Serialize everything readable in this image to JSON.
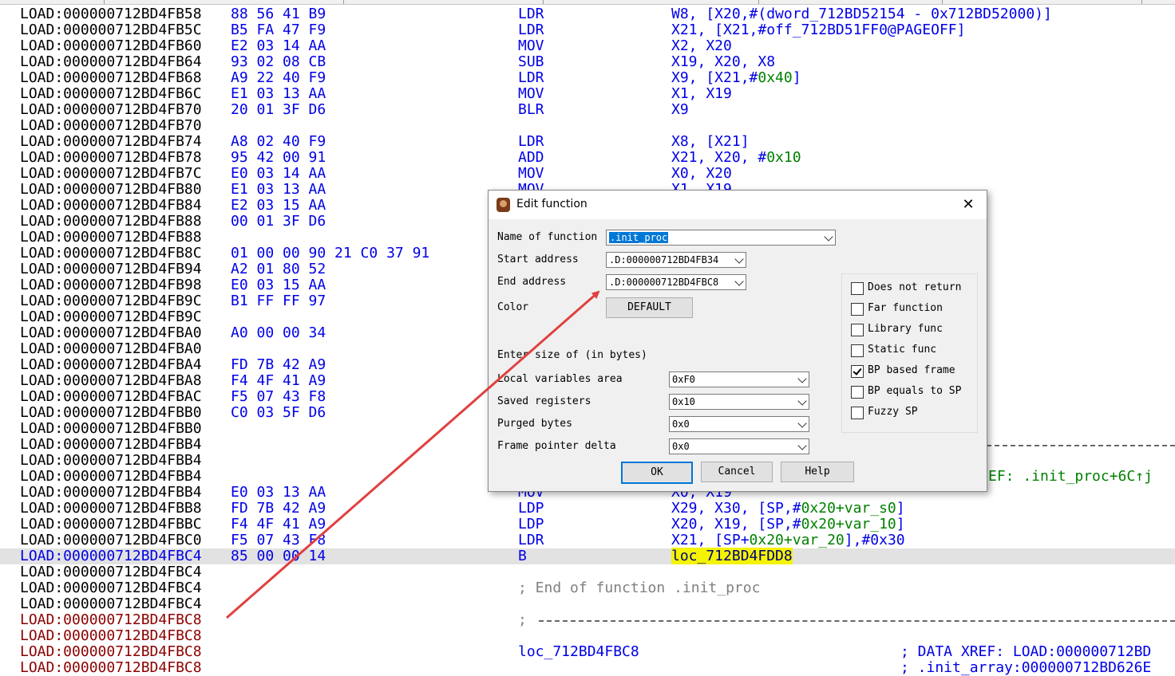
{
  "listing": {
    "rows": [
      {
        "addr": "LOAD:000000712BD4FB58",
        "bytes": "88 56 41 B9",
        "mnemonic": "LDR",
        "operands": "W8, [X20,#(dword_712BD52154 - 0x712BD52000)]"
      },
      {
        "addr": "LOAD:000000712BD4FB5C",
        "bytes": "B5 FA 47 F9",
        "mnemonic": "LDR",
        "operands": "X21, [X21,#off_712BD51FF0@PAGEOFF]"
      },
      {
        "addr": "LOAD:000000712BD4FB60",
        "bytes": "E2 03 14 AA",
        "mnemonic": "MOV",
        "operands": "X2, X20"
      },
      {
        "addr": "LOAD:000000712BD4FB64",
        "bytes": "93 02 08 CB",
        "mnemonic": "SUB",
        "operands": "X19, X20, X8"
      },
      {
        "addr": "LOAD:000000712BD4FB68",
        "bytes": "A9 22 40 F9",
        "mnemonic": "LDR",
        "operands": "X9, [X21,#",
        "operands_imm": "0x40",
        "operands_end": "]"
      },
      {
        "addr": "LOAD:000000712BD4FB6C",
        "bytes": "E1 03 13 AA",
        "mnemonic": "MOV",
        "operands": "X1, X19"
      },
      {
        "addr": "LOAD:000000712BD4FB70",
        "bytes": "20 01 3F D6",
        "mnemonic": "BLR",
        "operands": "X9"
      },
      {
        "addr": "LOAD:000000712BD4FB70",
        "bytes": "",
        "mnemonic": "",
        "operands": ""
      },
      {
        "addr": "LOAD:000000712BD4FB74",
        "bytes": "A8 02 40 F9",
        "mnemonic": "LDR",
        "operands": "X8, [X21]"
      },
      {
        "addr": "LOAD:000000712BD4FB78",
        "bytes": "95 42 00 91",
        "mnemonic": "ADD",
        "operands": "X21, X20, #",
        "operands_imm": "0x10",
        "operands_end": ""
      },
      {
        "addr": "LOAD:000000712BD4FB7C",
        "bytes": "E0 03 14 AA",
        "mnemonic": "MOV",
        "operands": "X0, X20"
      },
      {
        "addr": "LOAD:000000712BD4FB80",
        "bytes": "E1 03 13 AA",
        "mnemonic": "MOV",
        "operands": "X1, X19"
      },
      {
        "addr": "LOAD:000000712BD4FB84",
        "bytes": "E2 03 15 AA",
        "mnemonic": "",
        "operands": ""
      },
      {
        "addr": "LOAD:000000712BD4FB88",
        "bytes": "00 01 3F D6",
        "mnemonic": "",
        "operands": ""
      },
      {
        "addr": "LOAD:000000712BD4FB88",
        "bytes": "",
        "mnemonic": "",
        "operands": ""
      },
      {
        "addr": "LOAD:000000712BD4FB8C",
        "bytes": "01 00 00 90 21 C0 37 91",
        "mnemonic": "",
        "operands": ""
      },
      {
        "addr": "LOAD:000000712BD4FB94",
        "bytes": "A2 01 80 52",
        "mnemonic": "",
        "operands": ""
      },
      {
        "addr": "LOAD:000000712BD4FB98",
        "bytes": "E0 03 15 AA",
        "mnemonic": "",
        "operands": ""
      },
      {
        "addr": "LOAD:000000712BD4FB9C",
        "bytes": "B1 FF FF 97",
        "mnemonic": "",
        "operands": ""
      },
      {
        "addr": "LOAD:000000712BD4FB9C",
        "bytes": "",
        "mnemonic": "",
        "operands": ""
      },
      {
        "addr": "LOAD:000000712BD4FBA0",
        "bytes": "A0 00 00 34",
        "mnemonic": "",
        "operands": ""
      },
      {
        "addr": "LOAD:000000712BD4FBA0",
        "bytes": "",
        "mnemonic": "",
        "operands": ""
      },
      {
        "addr": "LOAD:000000712BD4FBA4",
        "bytes": "FD 7B 42 A9",
        "mnemonic": "",
        "operands": ""
      },
      {
        "addr": "LOAD:000000712BD4FBA8",
        "bytes": "F4 4F 41 A9",
        "mnemonic": "",
        "operands": ""
      },
      {
        "addr": "LOAD:000000712BD4FBAC",
        "bytes": "F5 07 43 F8",
        "mnemonic": "",
        "operands": ""
      },
      {
        "addr": "LOAD:000000712BD4FBB0",
        "bytes": "C0 03 5F D6",
        "mnemonic": "",
        "operands": ""
      },
      {
        "addr": "LOAD:000000712BD4FBB0",
        "bytes": "",
        "mnemonic": "",
        "operands": ""
      },
      {
        "addr": "LOAD:000000712BD4FBB4",
        "bytes": "",
        "mnemonic": "",
        "operands": ""
      },
      {
        "addr": "LOAD:000000712BD4FBB4",
        "bytes": "",
        "mnemonic": "",
        "operands": ""
      },
      {
        "addr": "LOAD:000000712BD4FBB4",
        "bytes": "",
        "mnemonic": "",
        "operands": "",
        "note": "EF: .init_proc+6C↑j"
      },
      {
        "addr": "LOAD:000000712BD4FBB4",
        "bytes": "E0 03 13 AA",
        "mnemonic": "MOV",
        "operands": "X0, X19"
      },
      {
        "addr": "LOAD:000000712BD4FBB8",
        "bytes": "FD 7B 42 A9",
        "mnemonic": "LDP",
        "operands": "X29, X30, [SP,#",
        "operands_imm": "0x20+var_s0",
        "operands_end": "]"
      },
      {
        "addr": "LOAD:000000712BD4FBBC",
        "bytes": "F4 4F 41 A9",
        "mnemonic": "LDP",
        "operands": "X20, X19, [SP,#",
        "operands_imm": "0x20+var_10",
        "operands_end": "]"
      },
      {
        "addr": "LOAD:000000712BD4FBC0",
        "bytes": "F5 07 43 F8",
        "mnemonic": "LDR",
        "operands": "X21, [SP+",
        "operands_imm": "0x20+var_20",
        "operands_end": "],#0x30"
      },
      {
        "addr": "LOAD:000000712BD4FBC4",
        "bytes": "85 00 00 14",
        "mnemonic": "B",
        "operands": "",
        "operands_label": "loc_712BD4FDD8"
      },
      {
        "addr": "LOAD:000000712BD4FBC4",
        "bytes": "",
        "mnemonic": "",
        "operands": ""
      },
      {
        "addr": "LOAD:000000712BD4FBC4",
        "bytes": "",
        "mnemonic": "",
        "operands": "",
        "comment": "; End of function .init_proc"
      },
      {
        "addr": "LOAD:000000712BD4FBC4",
        "bytes": "",
        "mnemonic": "",
        "operands": ""
      },
      {
        "addr": "LOAD:000000712BD4FBC8",
        "bytes": "",
        "mnemonic": "",
        "operands": "",
        "comment": "; "
      },
      {
        "addr": "LOAD:000000712BD4FBC8",
        "bytes": "",
        "mnemonic": "",
        "operands": ""
      },
      {
        "addr": "LOAD:000000712BD4FBC8",
        "bytes": "",
        "mnemonic": "",
        "operands": "",
        "label": "loc_712BD4FBC8",
        "xref1": "; DATA XREF: LOAD:000000712BD"
      },
      {
        "addr": "LOAD:000000712BD4FBC8",
        "bytes": "",
        "mnemonic": "",
        "operands": "",
        "xref2": "; .init_array:000000712BD626E"
      }
    ]
  },
  "dialog": {
    "title": "Edit function",
    "close_glyph": "✕",
    "name_label": "Name of function",
    "name_value": ".init_proc",
    "start_label": "Start address",
    "start_value": ".D:000000712BD4FB34",
    "end_label": "End address",
    "end_value": ".D:000000712BD4FBC8",
    "color_label": "Color",
    "color_button": "DEFAULT",
    "size_heading": "Enter size of (in bytes)",
    "local_label": "Local variables area",
    "local_value": "0xF0",
    "saved_label": "Saved registers",
    "saved_value": "0x10",
    "purged_label": "Purged bytes",
    "purged_value": "0x0",
    "fpd_label": "Frame pointer delta",
    "fpd_value": "0x0",
    "ok": "OK",
    "cancel": "Cancel",
    "help": "Help",
    "checkboxes": [
      {
        "label": "Does not return",
        "checked": false
      },
      {
        "label": "Far function",
        "checked": false
      },
      {
        "label": "Library func",
        "checked": false
      },
      {
        "label": "Static func",
        "checked": false
      },
      {
        "label": "BP based frame",
        "checked": true
      },
      {
        "label": "BP equals to SP",
        "checked": false
      },
      {
        "label": "Fuzzy SP",
        "checked": false
      }
    ]
  },
  "annotation": {
    "arrow_color": "#e04040"
  },
  "colors": {
    "address": "#000000",
    "code": "#0000e8",
    "immediate": "#008000",
    "label_highlight": "#f4f400",
    "red_address": "#8b0000",
    "selection": "#0078d7"
  }
}
